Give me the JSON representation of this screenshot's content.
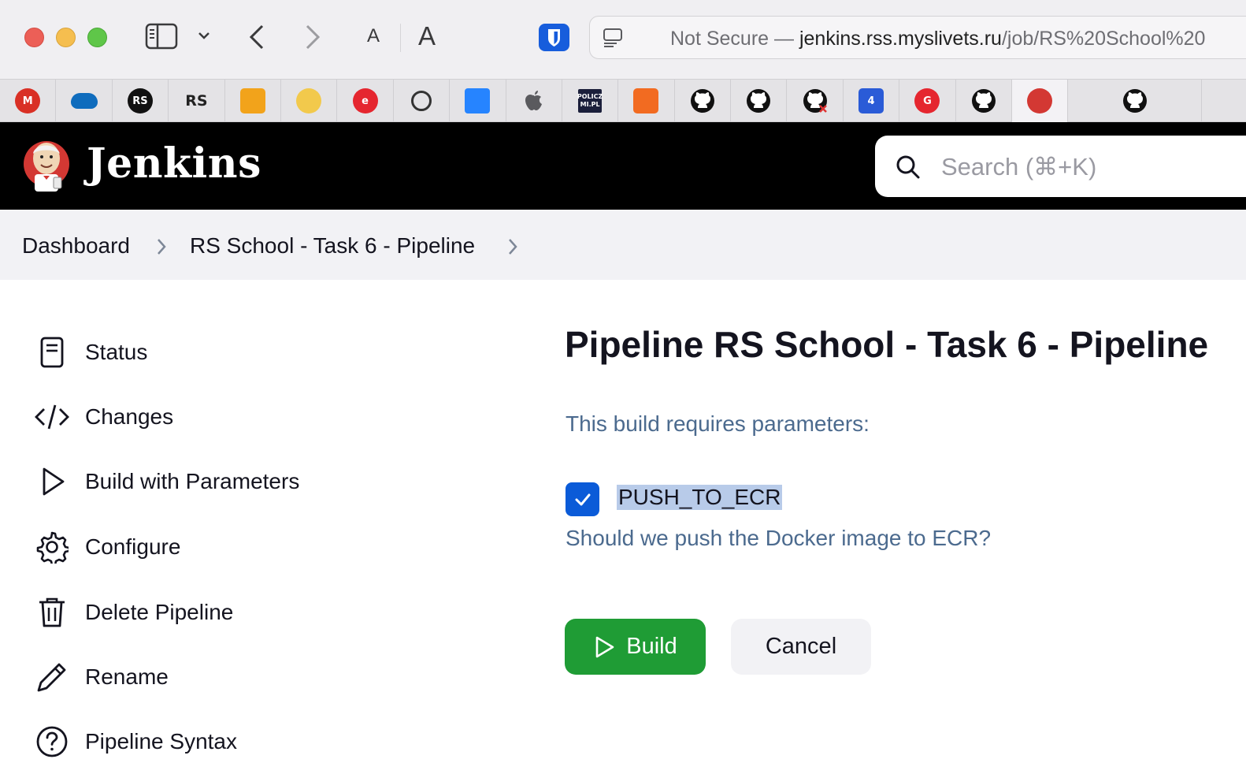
{
  "browser": {
    "font_small": "A",
    "font_large": "A",
    "url_prefix": "Not Secure — ",
    "url_host": "jenkins.rss.myslivets.ru",
    "url_path": "/job/RS%20School%20",
    "favorites": [
      {
        "icon": "gmail-icon",
        "label": "M",
        "color": "#d93025"
      },
      {
        "icon": "onedrive-icon",
        "label": "",
        "color": "#0f6cbd"
      },
      {
        "icon": "rs-school-round-icon",
        "label": "RS",
        "color": "#111111"
      },
      {
        "icon": "rs-school-icon",
        "label": "RS",
        "color": "#e4e3e6"
      },
      {
        "icon": "calendar-icon",
        "label": "",
        "color": "#f2a31b"
      },
      {
        "icon": "student-avatar-icon",
        "label": "",
        "color": "#f2c94c"
      },
      {
        "icon": "e-icon",
        "label": "e",
        "color": "#e5262f"
      },
      {
        "icon": "spiral-icon",
        "label": "",
        "color": "#e4e3e6"
      },
      {
        "icon": "jira-icon",
        "label": "",
        "color": "#e4e3e6"
      },
      {
        "icon": "apple-icon",
        "label": "",
        "color": "#e4e3e6"
      },
      {
        "icon": "policzmi-icon",
        "label": "POLICZ MI.PL",
        "color": "#1b1f3b"
      },
      {
        "icon": "cube-icon",
        "label": "",
        "color": "#f26b21"
      },
      {
        "icon": "github-icon",
        "label": "",
        "color": "#111111"
      },
      {
        "icon": "github-icon",
        "label": "",
        "color": "#111111"
      },
      {
        "icon": "github-error-icon",
        "label": "",
        "color": "#111111"
      },
      {
        "icon": "four-icon",
        "label": "4",
        "color": "#2a5bd7"
      },
      {
        "icon": "g-icon",
        "label": "G",
        "color": "#e5262f"
      },
      {
        "icon": "github-icon",
        "label": "",
        "color": "#111111"
      },
      {
        "icon": "jenkins-icon",
        "label": "",
        "color": "#d33833"
      },
      {
        "icon": "github-icon",
        "label": "",
        "color": "#111111"
      }
    ]
  },
  "header": {
    "title": "Jenkins",
    "search_placeholder": "Search (⌘+K)"
  },
  "breadcrumb": {
    "items": [
      "Dashboard",
      "RS School - Task 6 - Pipeline"
    ]
  },
  "sidebar": {
    "items": [
      {
        "label": "Status",
        "icon": "document-icon"
      },
      {
        "label": "Changes",
        "icon": "code-icon"
      },
      {
        "label": "Build with Parameters",
        "icon": "play-icon"
      },
      {
        "label": "Configure",
        "icon": "gear-icon"
      },
      {
        "label": "Delete Pipeline",
        "icon": "trash-icon"
      },
      {
        "label": "Rename",
        "icon": "pencil-icon"
      },
      {
        "label": "Pipeline Syntax",
        "icon": "help-icon"
      }
    ]
  },
  "main": {
    "title": "Pipeline RS School - Task 6 - Pipeline",
    "params_intro": "This build requires parameters:",
    "parameter": {
      "name": "PUSH_TO_ECR",
      "checked": true,
      "description": "Should we push the Docker image to ECR?"
    },
    "build_label": "Build",
    "cancel_label": "Cancel"
  },
  "colors": {
    "header_bg": "#000000",
    "build_button": "#1f9c35",
    "checkbox": "#0b5bd8",
    "description_text": "#4b6a8e"
  }
}
